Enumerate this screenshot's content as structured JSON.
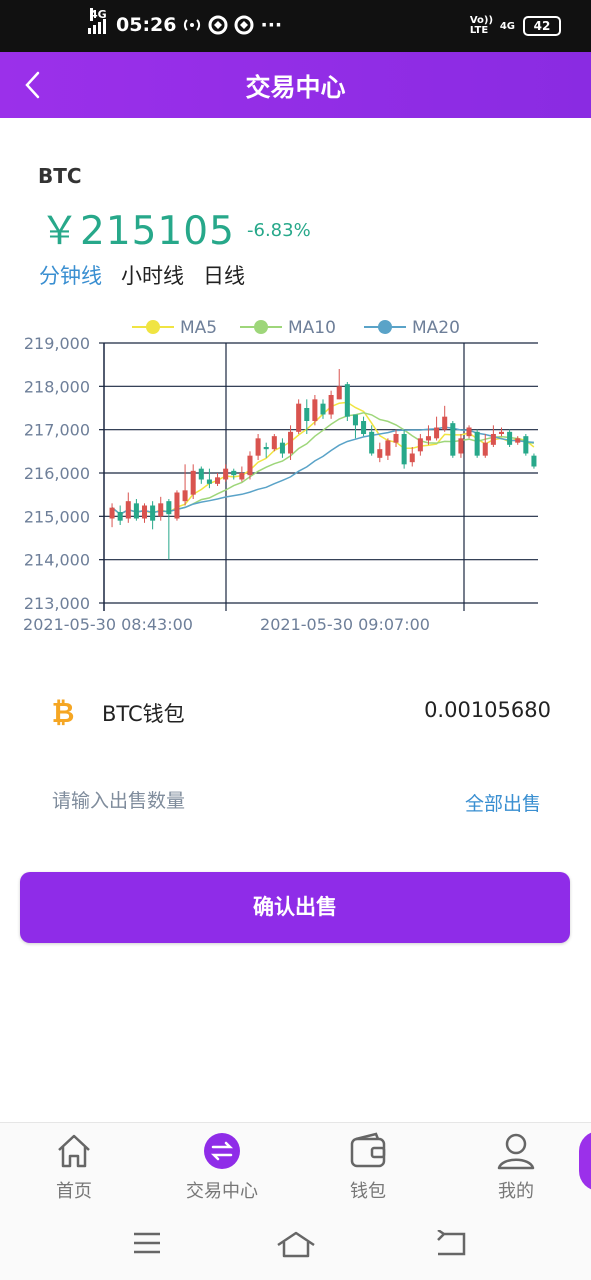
{
  "status_bar": {
    "network_left": "4G",
    "time": "05:26",
    "more": "···",
    "network_right": "4G",
    "volte": "Vo)) LTE",
    "battery": "42"
  },
  "header": {
    "title": "交易中心",
    "back_icon": "chevron-left-icon"
  },
  "asset": {
    "symbol": "BTC",
    "price": "￥215105",
    "change": "-6.83%"
  },
  "timeframe_tabs": [
    {
      "label": "分钟线",
      "active": true
    },
    {
      "label": "小时线",
      "active": false
    },
    {
      "label": "日线",
      "active": false
    }
  ],
  "chart_data": {
    "type": "candlestick",
    "y_ticks": [
      "219,000",
      "218,000",
      "217,000",
      "216,000",
      "215,000",
      "214,000",
      "213,000"
    ],
    "x_ticks": [
      "2021-05-30 08:43:00",
      "2021-05-30 09:07:00"
    ],
    "ylim": [
      213000,
      219000
    ],
    "legend": [
      {
        "name": "MA5",
        "color": "#f0e442"
      },
      {
        "name": "MA10",
        "color": "#9ed67a"
      },
      {
        "name": "MA20",
        "color": "#5aa3c8"
      }
    ],
    "legend_position": "top",
    "up_color": "#d9534f",
    "down_color": "#27a88a",
    "candles": [
      [
        214950,
        215200,
        215300,
        214750
      ],
      [
        215100,
        214900,
        215250,
        214800
      ],
      [
        214950,
        215350,
        215550,
        214850
      ],
      [
        215300,
        214950,
        215400,
        214900
      ],
      [
        214950,
        215250,
        215300,
        214850
      ],
      [
        215250,
        214900,
        215350,
        214700
      ],
      [
        215000,
        215300,
        215450,
        214900
      ],
      [
        215350,
        215050,
        215400,
        214000
      ],
      [
        214950,
        215550,
        215600,
        214900
      ],
      [
        215350,
        215600,
        216200,
        215250
      ],
      [
        215500,
        216050,
        216200,
        215400
      ],
      [
        216100,
        215850,
        216150,
        215750
      ],
      [
        215850,
        215750,
        216100,
        215650
      ],
      [
        215750,
        215900,
        216000,
        215700
      ],
      [
        215850,
        216100,
        216200,
        215800
      ],
      [
        216050,
        215950,
        216100,
        215850
      ],
      [
        215850,
        216000,
        216150,
        215800
      ],
      [
        215950,
        216400,
        216500,
        215850
      ],
      [
        216400,
        216800,
        216900,
        216300
      ],
      [
        216600,
        216550,
        216700,
        216350
      ],
      [
        216550,
        216850,
        216900,
        216500
      ],
      [
        216700,
        216450,
        216800,
        216350
      ],
      [
        216450,
        216950,
        217100,
        216300
      ],
      [
        216950,
        217600,
        217700,
        216900
      ],
      [
        217500,
        217200,
        217700,
        216900
      ],
      [
        217200,
        217700,
        217800,
        217100
      ],
      [
        217600,
        217350,
        217700,
        217250
      ],
      [
        217350,
        217800,
        217900,
        217250
      ],
      [
        217700,
        218000,
        218400,
        217700
      ],
      [
        218050,
        217300,
        218100,
        217200
      ],
      [
        217350,
        217100,
        217300,
        216800
      ],
      [
        217200,
        216900,
        217300,
        216850
      ],
      [
        216950,
        216450,
        217100,
        216400
      ],
      [
        216350,
        216550,
        216700,
        216250
      ],
      [
        216400,
        216750,
        216800,
        216300
      ],
      [
        216700,
        216900,
        217000,
        216600
      ],
      [
        216900,
        216200,
        217000,
        216100
      ],
      [
        216250,
        216450,
        216600,
        216150
      ],
      [
        216500,
        216800,
        216900,
        216400
      ],
      [
        216750,
        216850,
        217100,
        216650
      ],
      [
        216800,
        217050,
        217300,
        216750
      ],
      [
        217000,
        217300,
        217550,
        216950
      ],
      [
        217150,
        216400,
        217200,
        216350
      ],
      [
        216450,
        216800,
        216900,
        216350
      ],
      [
        216850,
        217050,
        217100,
        216800
      ],
      [
        216950,
        216400,
        217000,
        216350
      ],
      [
        216400,
        216700,
        216900,
        216350
      ],
      [
        216650,
        216900,
        217100,
        216600
      ],
      [
        216900,
        216950,
        217050,
        216850
      ],
      [
        216950,
        216650,
        217000,
        216600
      ],
      [
        216700,
        216800,
        216850,
        216650
      ],
      [
        216850,
        216450,
        216900,
        216400
      ],
      [
        216400,
        216150,
        216450,
        216100
      ]
    ]
  },
  "wallet": {
    "icon": "bitcoin-icon",
    "label": "BTC钱包",
    "balance": "0.00105680"
  },
  "sell_form": {
    "placeholder": "请输入出售数量",
    "sell_all": "全部出售",
    "confirm": "确认出售"
  },
  "bottom_nav": [
    {
      "label": "首页",
      "icon": "home-icon"
    },
    {
      "label": "交易中心",
      "icon": "exchange-icon",
      "active": true
    },
    {
      "label": "钱包",
      "icon": "wallet-icon"
    },
    {
      "label": "我的",
      "icon": "user-icon"
    }
  ],
  "system_nav": {
    "menu_icon": "menu-icon",
    "home_icon": "home-outline-icon",
    "back_icon": "back-icon"
  }
}
